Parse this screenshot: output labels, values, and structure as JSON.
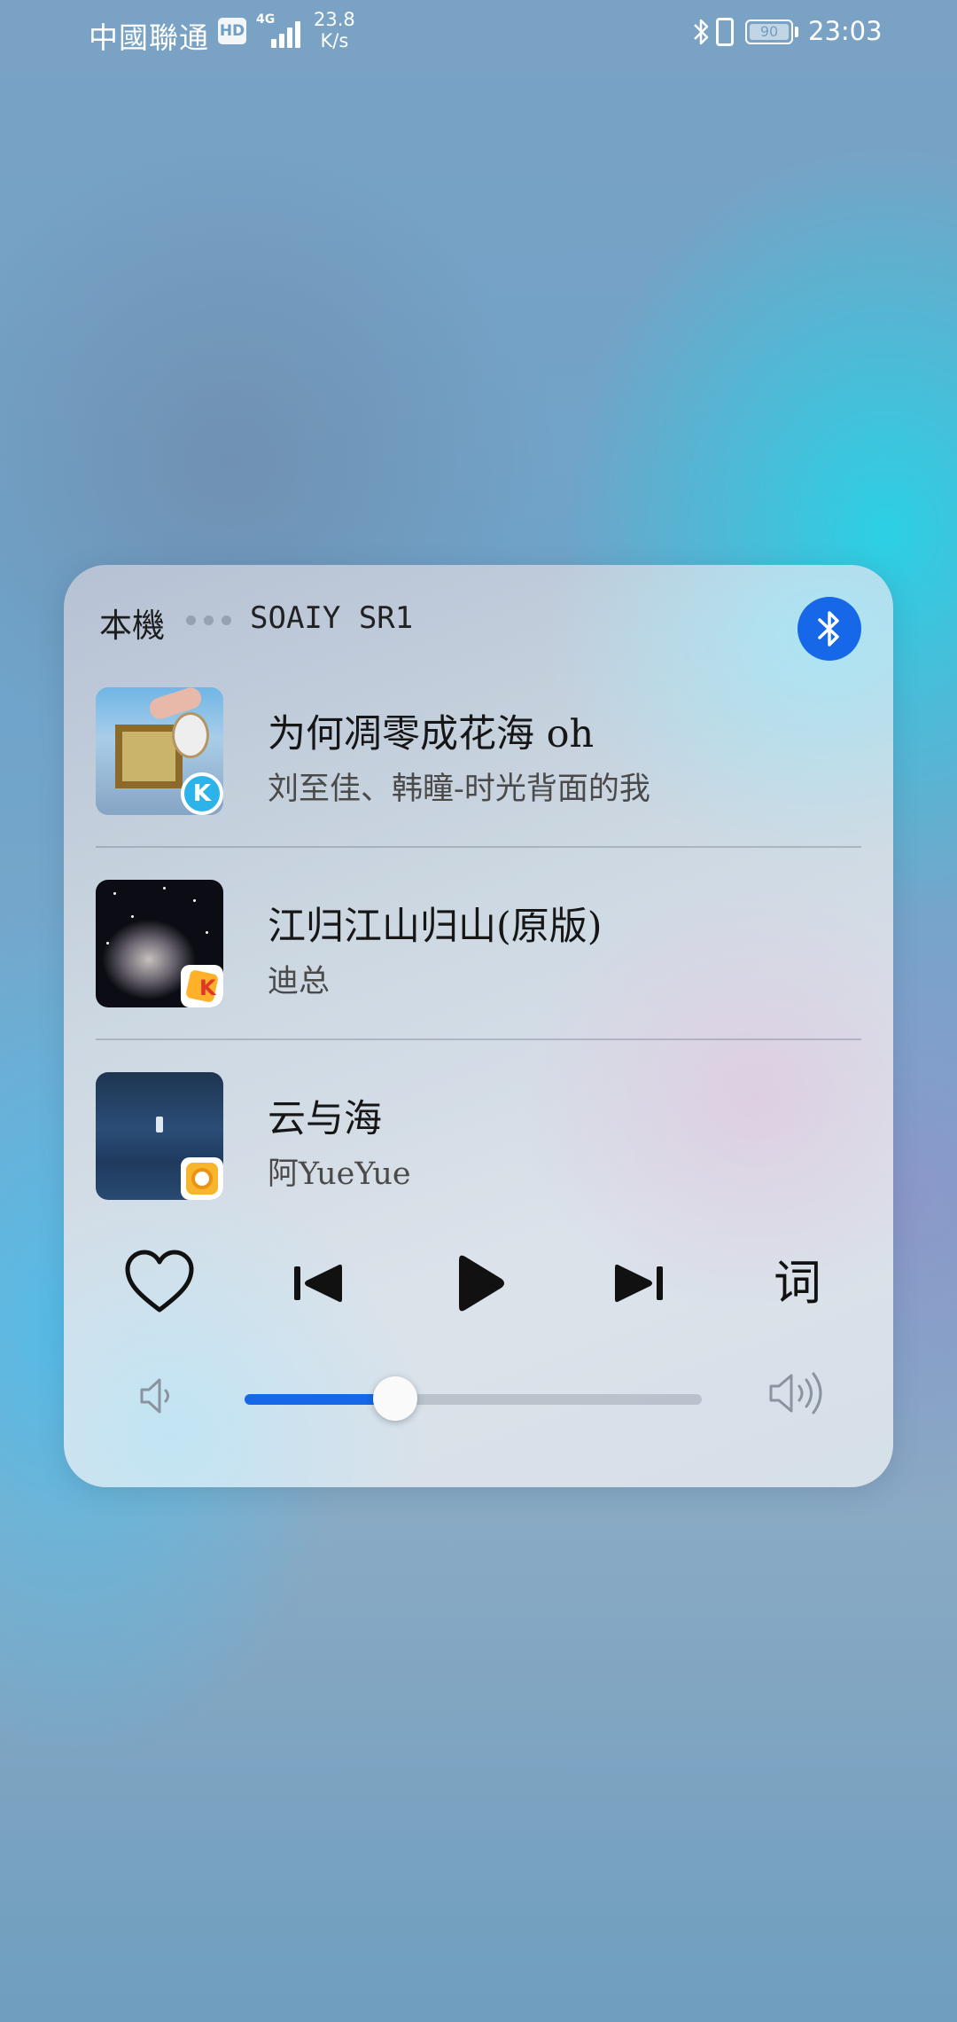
{
  "status_bar": {
    "carrier": "中國聯通",
    "hd": "HD",
    "network_type": "4G",
    "speed_value": "23.8",
    "speed_unit": "K/s",
    "battery": "90",
    "time": "23:03"
  },
  "card": {
    "device_label": "本機",
    "device_name": "SOAIY SR1",
    "bluetooth_icon": "bluetooth-icon",
    "songs": [
      {
        "title": "为何凋零成花海 oh",
        "artist": "刘至佳、韩瞳-时光背面的我",
        "app_icon": "kugou-music-icon"
      },
      {
        "title": "江归江山归山(原版)",
        "artist": "迪总",
        "app_icon": "kuaishou-k-icon"
      },
      {
        "title": "云与海",
        "artist": "阿YueYue",
        "app_icon": "music-disc-icon"
      }
    ],
    "controls": {
      "like_icon": "heart-icon",
      "prev_icon": "previous-icon",
      "play_icon": "play-icon",
      "next_icon": "next-icon",
      "lyrics_label": "词"
    },
    "volume": {
      "level": 0.33,
      "low_icon": "volume-low-icon",
      "high_icon": "volume-high-icon"
    }
  },
  "colors": {
    "accent": "#1668e8",
    "text_primary": "#161616",
    "text_secondary": "#4a4a4a"
  }
}
